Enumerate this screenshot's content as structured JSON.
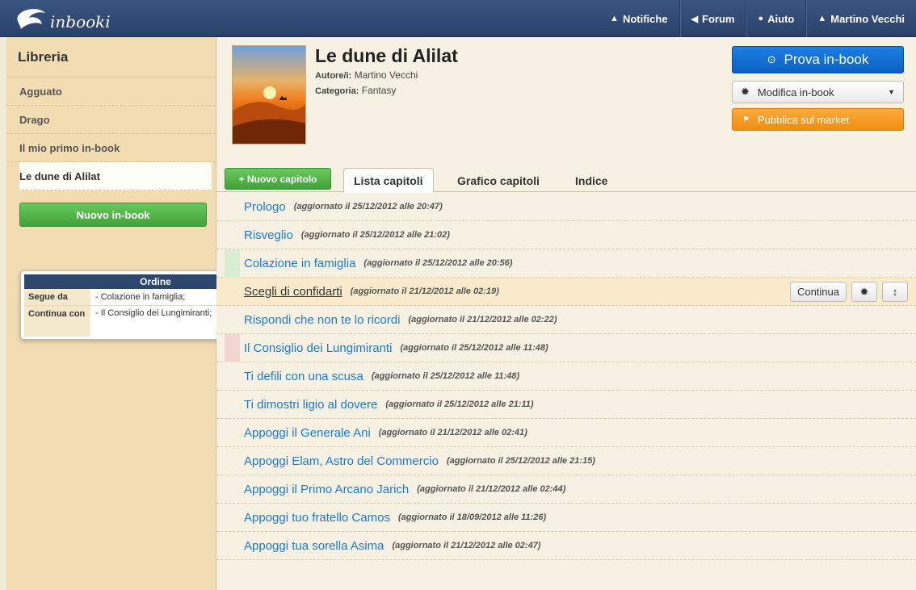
{
  "app": {
    "logo_text": "inbooki"
  },
  "topnav": [
    {
      "icon": "bell-icon",
      "glyph": "▲",
      "label": "Notifiche"
    },
    {
      "icon": "megaphone-icon",
      "glyph": "◀",
      "label": "Forum"
    },
    {
      "icon": "info-icon",
      "glyph": "●",
      "label": "Aiuto"
    },
    {
      "icon": "user-icon",
      "glyph": "▲",
      "label": "Martino Vecchi"
    }
  ],
  "sidebar": {
    "title": "Libreria",
    "items": [
      {
        "label": "Agguato"
      },
      {
        "label": "Drago"
      },
      {
        "label": "Il mio primo in-book"
      },
      {
        "label": "Le dune di Alilat"
      }
    ],
    "new_button": "Nuovo in-book"
  },
  "order_popup": {
    "title": "Ordine",
    "follows_label": "Segue da",
    "follows_value": "- Colazione in famiglia;",
    "continues_label": "Continua con",
    "continues_value": "- Il Consiglio dei Lungimiranti;"
  },
  "book": {
    "title": "Le dune di Alilat",
    "author_label": "Autore/i:",
    "author": "Martino Vecchi",
    "category_label": "Categoria:",
    "category": "Fantasy"
  },
  "actions": {
    "try_label": "Prova in-book",
    "edit_label": "Modifica in-book",
    "publish_label": "Pubblica sul market"
  },
  "tabs": {
    "new_chapter": "+ Nuovo capitolo",
    "list": "Lista capitoli",
    "graph": "Grafico capitoli",
    "index": "Indice"
  },
  "chapters": [
    {
      "title": "Prologo",
      "date": "(aggiornato il 25/12/2012 alle 20:47)"
    },
    {
      "title": "Risveglio",
      "date": "(aggiornato il 25/12/2012 alle 21:02)"
    },
    {
      "title": "Colazione in famiglia",
      "date": "(aggiornato il 25/12/2012 alle 20:56)"
    },
    {
      "title": "Scegli di confidarti",
      "date": "(aggiornato il 21/12/2012 alle 02:19)"
    },
    {
      "title": "Rispondi che non te lo ricordi",
      "date": "(aggiornato il 21/12/2012 alle 02:22)"
    },
    {
      "title": "Il Consiglio dei Lungimiranti",
      "date": "(aggiornato il 25/12/2012 alle 11:48)"
    },
    {
      "title": "Ti defili con una scusa",
      "date": "(aggiornato il 25/12/2012 alle 11:48)"
    },
    {
      "title": "Ti dimostri ligio al dovere",
      "date": "(aggiornato il 25/12/2012 alle 21:11)"
    },
    {
      "title": "Appoggi il Generale Ani",
      "date": "(aggiornato il 21/12/2012 alle 02:41)"
    },
    {
      "title": "Appoggi Elam, Astro del Commercio",
      "date": "(aggiornato il 25/12/2012 alle 21:15)"
    },
    {
      "title": "Appoggi il Primo Arcano Jarich",
      "date": "(aggiornato il 21/12/2012 alle 02:44)"
    },
    {
      "title": "Appoggi tuo fratello Camos",
      "date": "(aggiornato il 18/09/2012 alle 11:26)"
    },
    {
      "title": "Appoggi tua sorella Asima",
      "date": "(aggiornato il 21/12/2012 alle 02:47)"
    }
  ],
  "chapter_actions": {
    "continue_label": "Continua"
  },
  "colors": {
    "accent": "#1f7ac8",
    "topbar": "#2f4a76",
    "sidebar": "#f2ddb3",
    "highlight": "#faebcd"
  }
}
